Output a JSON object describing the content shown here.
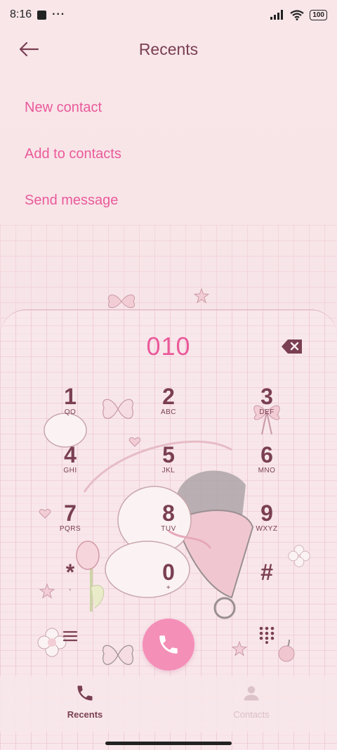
{
  "status_bar": {
    "time": "8:16",
    "dots": "···",
    "battery": "100"
  },
  "header": {
    "title": "Recents"
  },
  "menu": {
    "items": [
      "New contact",
      "Add to contacts",
      "Send message"
    ]
  },
  "dialer": {
    "number": "010",
    "keys": [
      {
        "digit": "1",
        "letters": "QO"
      },
      {
        "digit": "2",
        "letters": "ABC"
      },
      {
        "digit": "3",
        "letters": "DEF"
      },
      {
        "digit": "4",
        "letters": "GHI"
      },
      {
        "digit": "5",
        "letters": "JKL"
      },
      {
        "digit": "6",
        "letters": "MNO"
      },
      {
        "digit": "7",
        "letters": "PQRS"
      },
      {
        "digit": "8",
        "letters": "TUV"
      },
      {
        "digit": "9",
        "letters": "WXYZ"
      },
      {
        "digit": "*",
        "letters": ","
      },
      {
        "digit": "0",
        "letters": "+"
      },
      {
        "digit": "#",
        "letters": ""
      }
    ]
  },
  "bottom_nav": {
    "recents_label": "Recents",
    "contacts_label": "Contacts"
  },
  "colors": {
    "accent": "#ea5a9a",
    "text": "#7a3f53",
    "call_button": "#f48fb8"
  },
  "icons": {
    "back": "arrow-left-icon",
    "backspace": "backspace-icon",
    "call": "phone-icon",
    "menu": "menu-icon",
    "keypad": "dialpad-icon",
    "recents": "phone-icon",
    "contacts": "person-icon"
  }
}
